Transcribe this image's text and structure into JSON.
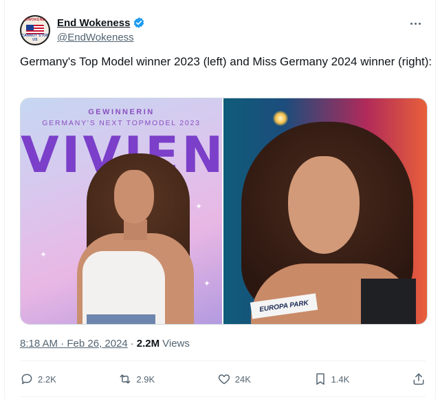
{
  "author": {
    "display_name": "End Wokeness",
    "handle": "@EndWokeness",
    "verified": true,
    "avatar_text_top": "ENDWOKENESS",
    "avatar_text_bottom": "CANNOT STOP US"
  },
  "tweet": {
    "text": "Germany's Top Model winner 2023 (left) and Miss Germany 2024 winner (right):"
  },
  "media": {
    "left": {
      "poster_line1": "GEWINNERIN",
      "poster_line2": "GERMANY'S NEXT TOPMODEL 2023",
      "poster_name": "VIVIEN"
    },
    "right": {
      "sash_text": "EUROPA PARK"
    }
  },
  "meta": {
    "time": "8:18 AM · Feb 26, 2024",
    "separator": "·",
    "views_count": "2.2M",
    "views_label": "Views"
  },
  "actions": {
    "reply": {
      "icon": "reply-icon",
      "count": "2.2K"
    },
    "retweet": {
      "icon": "retweet-icon",
      "count": "2.9K"
    },
    "like": {
      "icon": "heart-icon",
      "count": "24K"
    },
    "bookmark": {
      "icon": "bookmark-icon",
      "count": "1.4K"
    },
    "share": {
      "icon": "share-icon"
    }
  },
  "colors": {
    "verified": "#1d9bf0",
    "secondary_text": "#536471",
    "primary_text": "#0f1419"
  }
}
